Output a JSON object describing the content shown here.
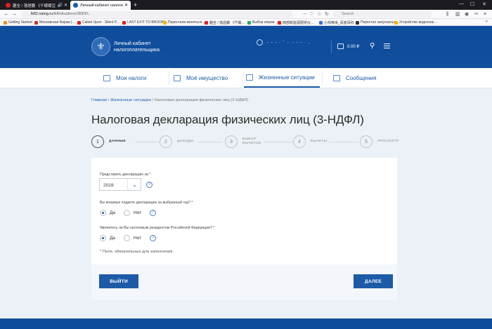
{
  "browser": {
    "tabs": [
      {
        "label": "趣全 / 落語聽 《千蝶蝶豆豆鼓》",
        "color": "#e02020"
      },
      {
        "label": "Личный кабинет налогоплате",
        "color": "#1d5ba8"
      }
    ],
    "url_host": "lkfl2.nalog.ru",
    "url_path": "/lkfl/situations/3NDFL",
    "search_placeholder": "Search",
    "bookmarks": [
      {
        "label": "Getting Started",
        "color": "#f08a24"
      },
      {
        "label": "Московская Биржа |...",
        "color": "#c0392b"
      },
      {
        "label": "Called Upon - Silent P...",
        "color": "#e02020"
      },
      {
        "label": "LAST EXIT TO BROOKL...",
        "color": "#e02020"
      },
      {
        "label": "Перестали меняться ...",
        "color": "#f0b400"
      },
      {
        "label": "趣全 / 落語聽 《千蝶...",
        "color": "#e02020"
      },
      {
        "label": "Выбор оккуки",
        "color": "#27ae60"
      },
      {
        "label": "西部新能源颁奖仪...",
        "color": "#e02020"
      },
      {
        "label": "小鸡啄米_百度百科",
        "color": "#3b6fd8"
      },
      {
        "label": "Перестал запускаться...",
        "color": "#333333"
      },
      {
        "label": "Устройство видеосик...",
        "color": "#f0b400"
      }
    ]
  },
  "header": {
    "brand_line1": "Личный кабинет",
    "brand_line2": "налогоплательщика",
    "user_name": "- - - · ' ·· - - - · ,",
    "balance": "0.00 ₽"
  },
  "nav": [
    {
      "label": "Мои налоги"
    },
    {
      "label": "Моё имущество"
    },
    {
      "label": "Жизненные ситуации"
    },
    {
      "label": "Сообщения"
    }
  ],
  "breadcrumb": {
    "home": "Главная",
    "sep": " / ",
    "section": "Жизненные ситуации",
    "current": "Налоговая декларация физических лиц (3-НДФЛ)"
  },
  "page_title": "Налоговая декларация физических лиц (3-НДФЛ)",
  "steps": [
    {
      "num": "1",
      "label": "ДАННЫЕ"
    },
    {
      "num": "2",
      "label": "ДОХОДЫ"
    },
    {
      "num": "3",
      "label": "ВЫБОР\nВЫЧЕТОВ"
    },
    {
      "num": "4",
      "label": "ВЫЧЕТЫ"
    },
    {
      "num": "5",
      "label": "ПРОСМОТР"
    }
  ],
  "form": {
    "year_label": "Представить декларацию за *",
    "year_value": "2019",
    "first_time_label": "Вы впервые подаете декларацию за выбранный год? *",
    "resident_label": "Являетесь ли Вы налоговым резидентом Российской Федерации? *",
    "yes": "Да",
    "no": "Нет",
    "help": "?",
    "required_note": "* Поля, обязательные для заполнения"
  },
  "buttons": {
    "exit": "ВЫЙТИ",
    "next": "ДАЛЕЕ"
  }
}
